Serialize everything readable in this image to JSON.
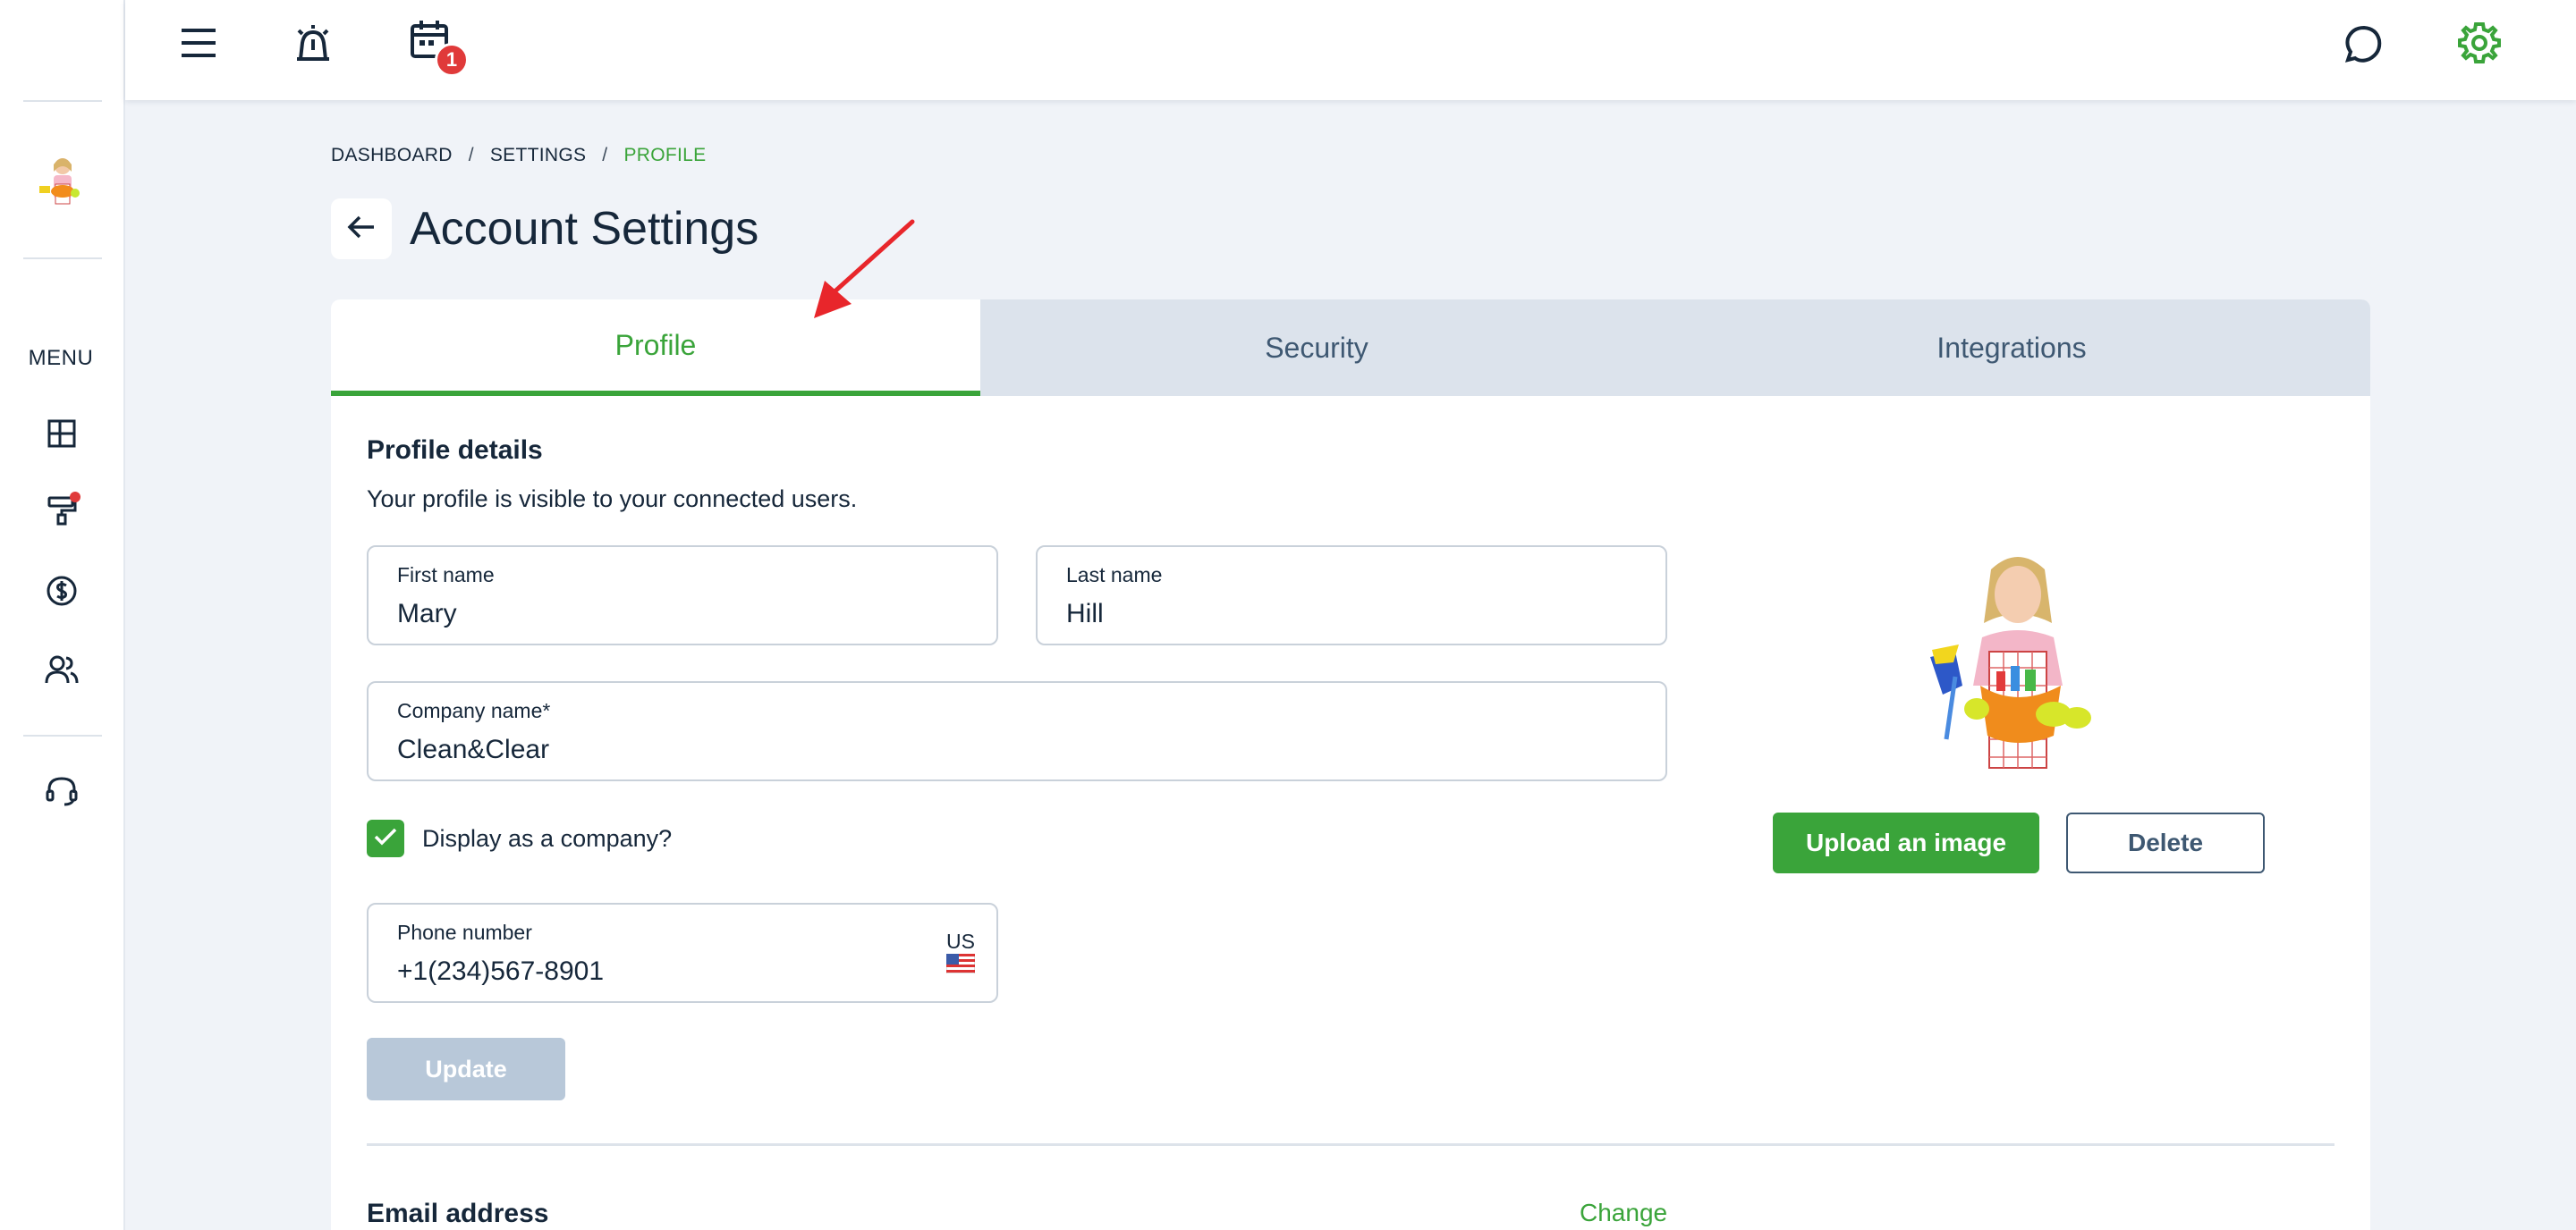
{
  "sidebar": {
    "menu_label": "MENU",
    "items": [
      {
        "icon": "dashboard-icon"
      },
      {
        "icon": "paint-roller-icon",
        "has_notification": true
      },
      {
        "icon": "dollar-icon"
      },
      {
        "icon": "users-icon"
      },
      {
        "icon": "headset-icon"
      }
    ]
  },
  "topbar": {
    "icons": [
      "menu-icon",
      "alarm-icon",
      "calendar-icon",
      "chat-icon",
      "gear-icon"
    ],
    "calendar_badge": "1"
  },
  "breadcrumb": {
    "items": [
      "DASHBOARD",
      "SETTINGS",
      "PROFILE"
    ],
    "separator": "/"
  },
  "page": {
    "title": "Account Settings"
  },
  "tabs": [
    {
      "label": "Profile",
      "active": true
    },
    {
      "label": "Security",
      "active": false
    },
    {
      "label": "Integrations",
      "active": false
    }
  ],
  "profile": {
    "section_title": "Profile details",
    "section_desc": "Your profile is visible to your connected users.",
    "first_name_label": "First name",
    "first_name": "Mary",
    "last_name_label": "Last name",
    "last_name": "Hill",
    "company_label": "Company name*",
    "company": "Clean&Clear",
    "display_company_label": "Display as a company?",
    "display_company_checked": true,
    "phone_label": "Phone number",
    "phone": "+1(234)567-8901",
    "phone_country": "US",
    "update_label": "Update",
    "upload_label": "Upload an image",
    "delete_label": "Delete"
  },
  "email": {
    "title": "Email address",
    "change_label": "Change"
  },
  "colors": {
    "accent": "#3aa43a",
    "text": "#16273a",
    "muted": "#3e5872",
    "tab_bg": "#dce3ec",
    "disabled": "#b8c8d9",
    "badge": "#e03a3a",
    "annotation": "#e8262b"
  }
}
